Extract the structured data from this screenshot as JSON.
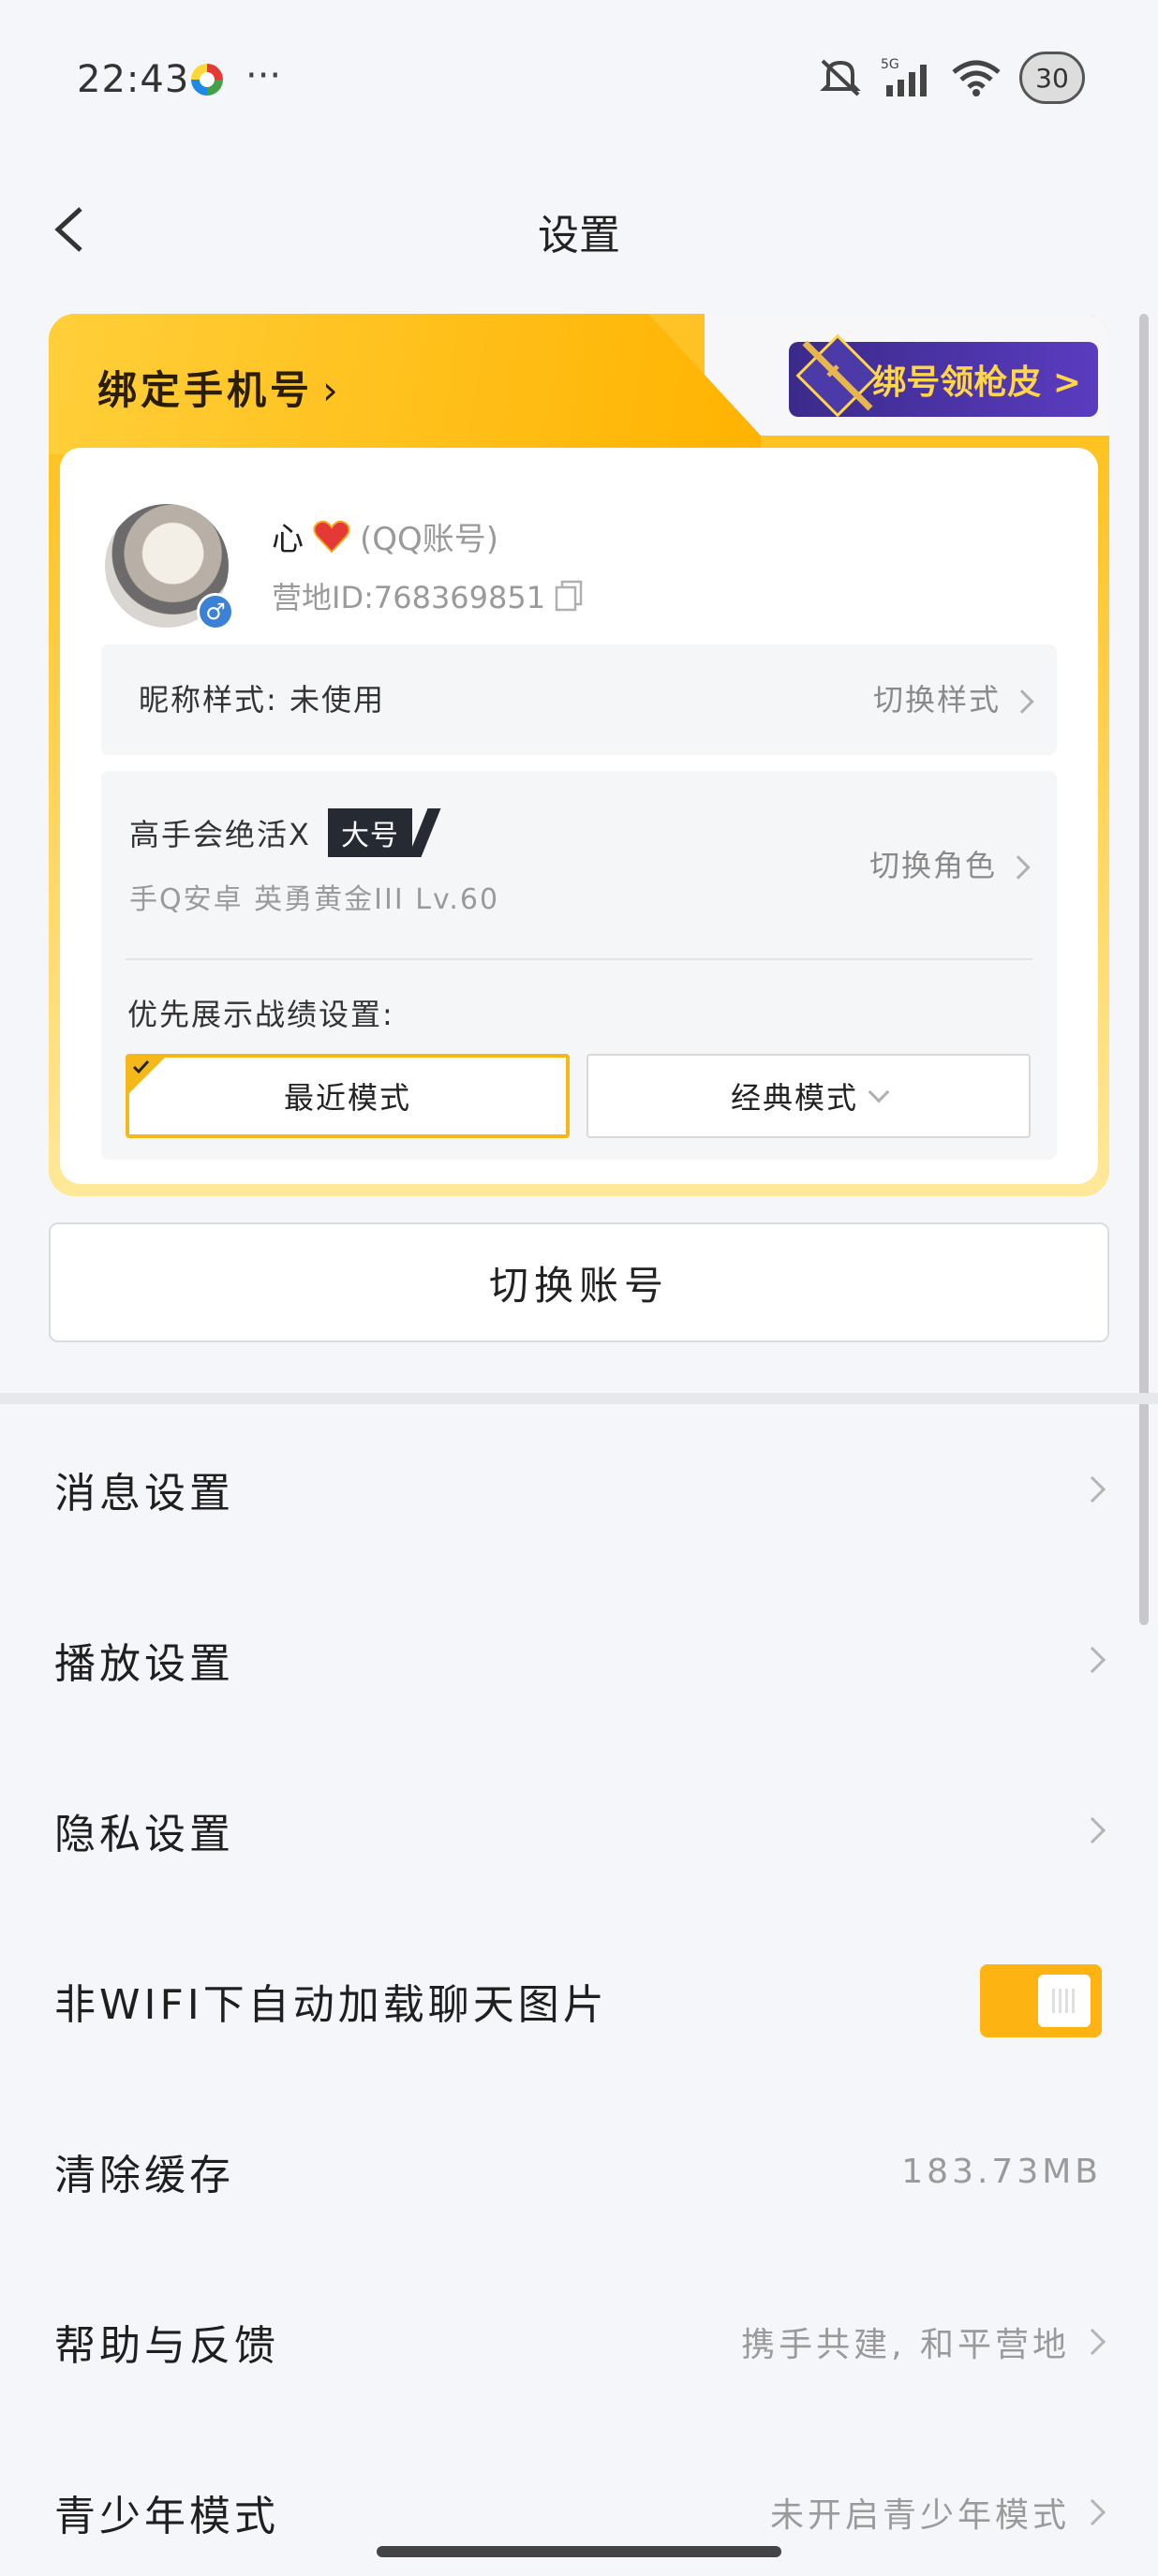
{
  "status_bar": {
    "time": "22:43",
    "more": "···",
    "battery": "30",
    "network": "5G"
  },
  "header": {
    "title": "设置"
  },
  "account_card": {
    "bind_phone": "绑定手机号",
    "skin_banner": "绑号领枪皮 >",
    "user_name": "心",
    "user_name_sub": "(QQ账号)",
    "camp_id": "营地ID:768369851",
    "nick_style_label": "昵称样式: 未使用",
    "nick_style_switch": "切换样式",
    "role_name": "高手会绝活X",
    "main_account_badge": "大号",
    "role_info": "手Q安卓 英勇黄金III Lv.60",
    "switch_role": "切换角色",
    "priority_label": "优先展示战绩设置:",
    "mode_recent": "最近模式",
    "mode_classic": "经典模式"
  },
  "switch_account": "切换账号",
  "settings": [
    {
      "label": "消息设置",
      "value": "",
      "type": "chevron"
    },
    {
      "label": "播放设置",
      "value": "",
      "type": "chevron"
    },
    {
      "label": "隐私设置",
      "value": "",
      "type": "chevron"
    },
    {
      "label": "非WIFI下自动加载聊天图片",
      "value": "",
      "type": "toggle",
      "on": true
    },
    {
      "label": "清除缓存",
      "value": "183.73MB",
      "type": "value"
    },
    {
      "label": "帮助与反馈",
      "value": "携手共建, 和平营地",
      "type": "chevron"
    },
    {
      "label": "青少年模式",
      "value": "未开启青少年模式",
      "type": "chevron"
    }
  ],
  "colors": {
    "accent": "#fdb412",
    "card_gold": "#ffc21f",
    "badge_dark": "#262a33"
  }
}
